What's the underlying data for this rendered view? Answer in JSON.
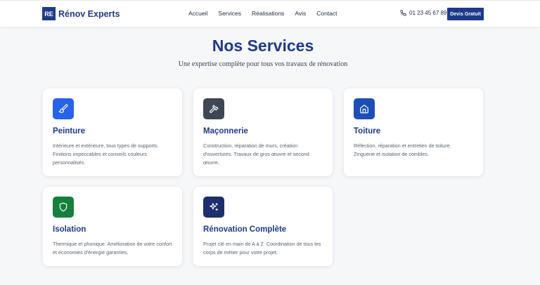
{
  "header": {
    "logo_badge": "RE",
    "logo_text": "Rénov Experts",
    "nav": [
      "Accueil",
      "Services",
      "Réalisations",
      "Avis",
      "Contact"
    ],
    "phone": "01 23 45 67 89",
    "cta": "Devis Gratuit"
  },
  "section": {
    "title": "Nos Services",
    "subtitle": "Une expertise complète pour tous vos travaux de rénovation"
  },
  "colors": {
    "brand": "#1e3a8a",
    "icon_peinture": "#2563eb",
    "icon_maconnerie": "#3f4756",
    "icon_toiture": "#1d4fb8",
    "icon_isolation": "#15803d",
    "icon_renovation": "#1e2f6e"
  },
  "services": [
    {
      "icon": "paintbrush-icon",
      "title": "Peinture",
      "desc": "Intérieure et extérieure, tous types de supports. Finitions impeccables et conseils couleurs personnalisés."
    },
    {
      "icon": "hammer-icon",
      "title": "Maçonnerie",
      "desc": "Construction, réparation de murs, création d'ouvertures. Travaux de gros œuvre et second œuvre."
    },
    {
      "icon": "house-icon",
      "title": "Toiture",
      "desc": "Réfection, réparation et entretien de toiture. Zinguerie et isolation de combles."
    },
    {
      "icon": "shield-icon",
      "title": "Isolation",
      "desc": "Thermique et phonique. Amélioration de votre confort et économies d'énergie garanties."
    },
    {
      "icon": "sparkles-icon",
      "title": "Rénovation Complète",
      "desc": "Projet clé en main de A à Z. Coordination de tous les corps de métier pour votre projet."
    }
  ]
}
